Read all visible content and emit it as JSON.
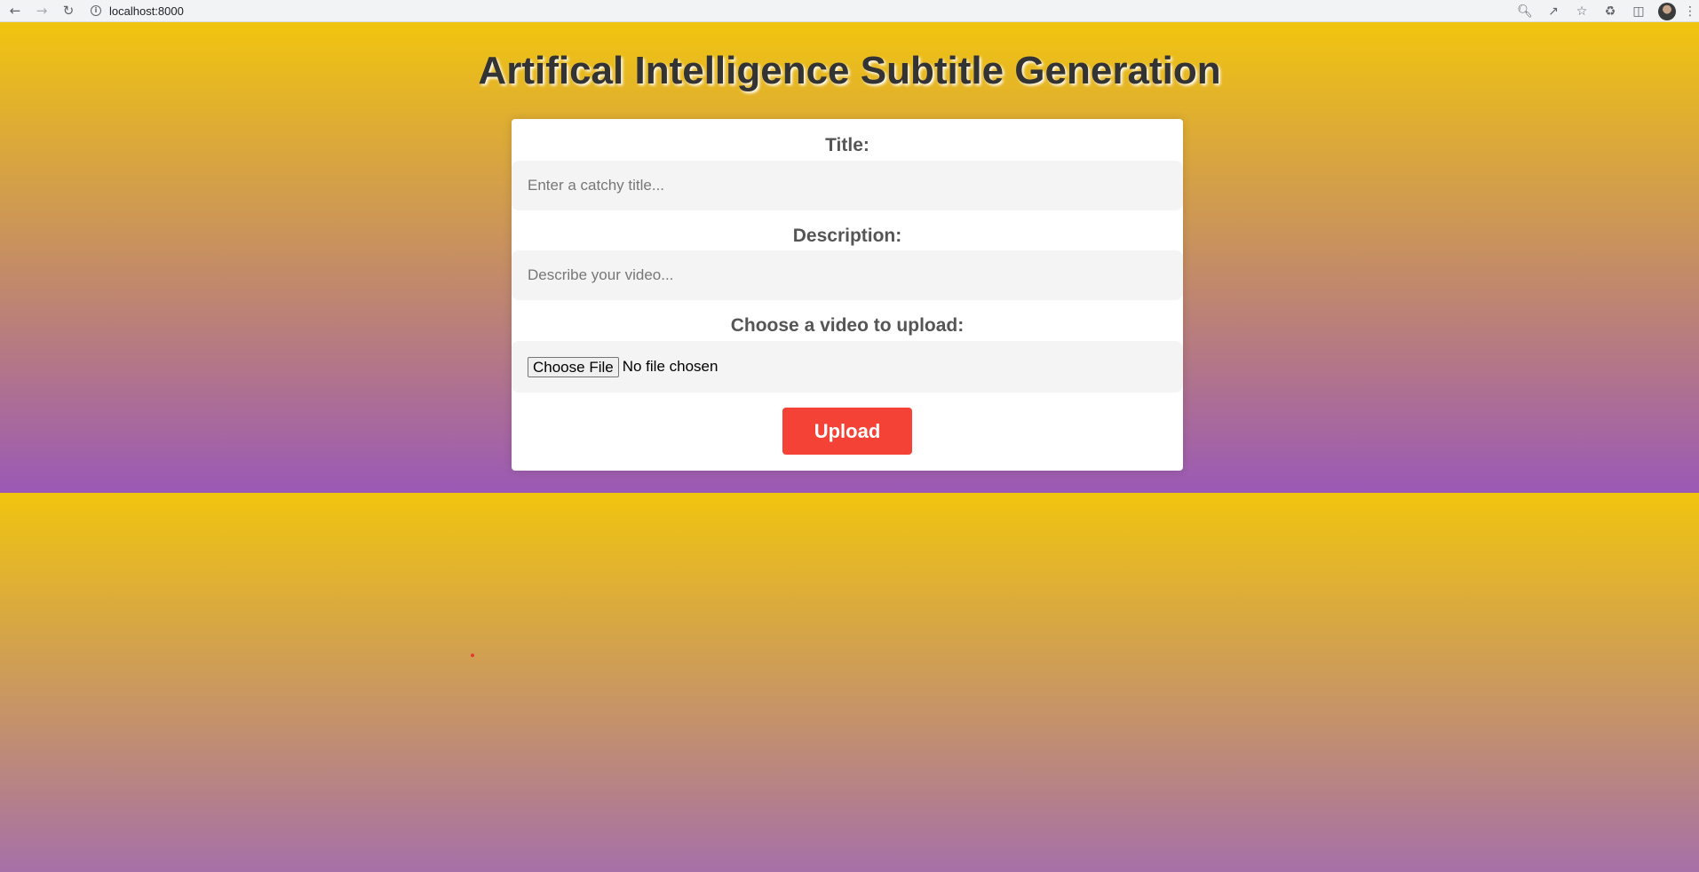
{
  "browser": {
    "url": "localhost:8000",
    "info_icon": "i"
  },
  "page": {
    "title": "Artifical Intelligence Subtitle Generation"
  },
  "form": {
    "title_label": "Title:",
    "title_placeholder": "Enter a catchy title...",
    "description_label": "Description:",
    "description_placeholder": "Describe your video...",
    "video_label": "Choose a video to upload:",
    "choose_file_label": "Choose File",
    "file_status": "No file chosen",
    "upload_label": "Upload"
  },
  "colors": {
    "gradient_top": "#f1c40f",
    "gradient_bottom": "#9b59b6",
    "upload_button": "#f44336"
  }
}
